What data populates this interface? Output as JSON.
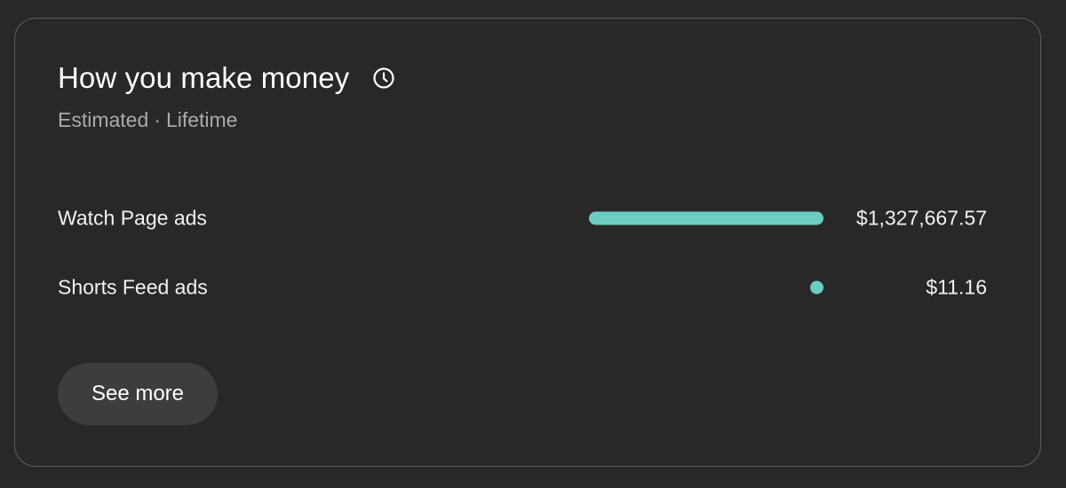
{
  "card": {
    "title": "How you make money",
    "info_icon": "clock-icon",
    "subtitle_prefix": "Estimated",
    "subtitle_separator": "·",
    "subtitle_period": "Lifetime"
  },
  "revenue_sources": [
    {
      "label": "Watch Page ads",
      "value": "$1,327,667.57",
      "amount": 1327667.57,
      "share": 1.0
    },
    {
      "label": "Shorts Feed ads",
      "value": "$11.16",
      "amount": 11.16,
      "share": 8.4e-06
    }
  ],
  "see_more_label": "See more",
  "colors": {
    "background": "#282828",
    "bar": "#6ccdc4",
    "button": "#3d3d3d",
    "border": "#5f5f5f"
  }
}
